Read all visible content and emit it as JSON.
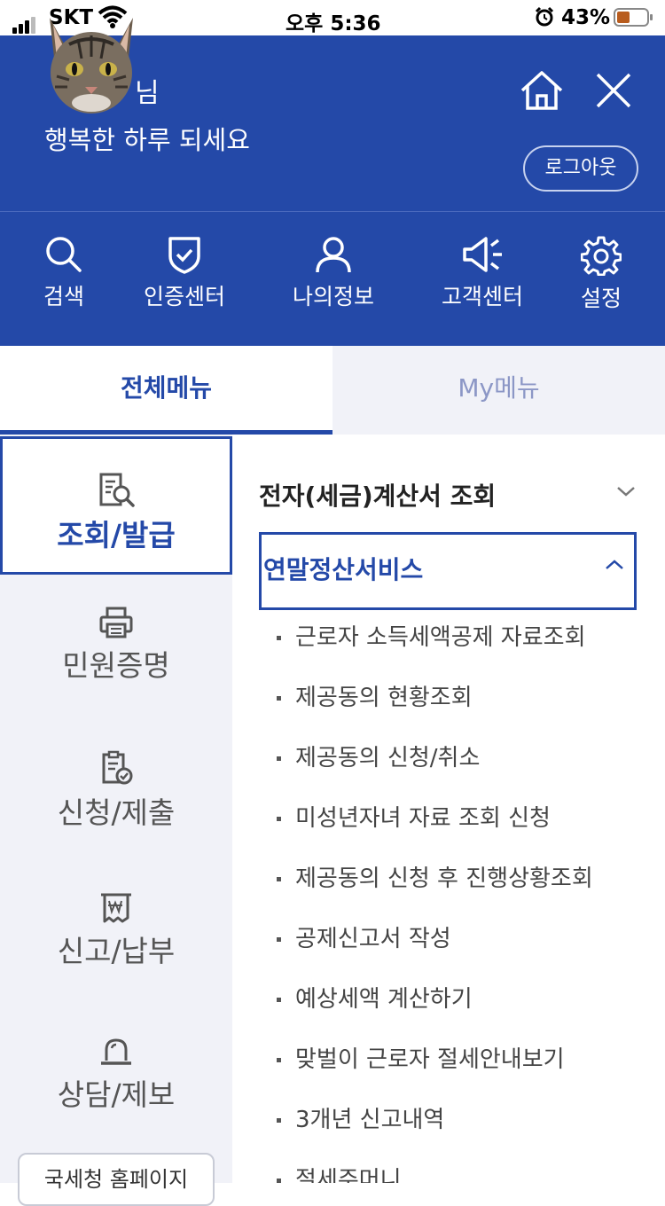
{
  "status_bar": {
    "carrier": "SKT",
    "time": "오후 5:36",
    "battery_percent": "43%",
    "battery_level": 0.43
  },
  "header": {
    "greeting_name_suffix": "님",
    "greeting_message": "행복한 하루 되세요",
    "logout_label": "로그아웃",
    "home_icon": "home-icon",
    "close_icon": "close-icon",
    "bg_color": "#2449a8"
  },
  "quick_nav": [
    {
      "label": "검색",
      "icon": "search-icon"
    },
    {
      "label": "인증센터",
      "icon": "shield-check-icon"
    },
    {
      "label": "나의정보",
      "icon": "person-icon"
    },
    {
      "label": "고객센터",
      "icon": "megaphone-icon"
    },
    {
      "label": "설정",
      "icon": "gear-icon"
    }
  ],
  "tabs": [
    {
      "label": "전체메뉴",
      "active": true
    },
    {
      "label": "My메뉴",
      "active": false
    }
  ],
  "categories": [
    {
      "label": "조회/발급",
      "icon": "document-search-icon",
      "active": true
    },
    {
      "label": "민원증명",
      "icon": "printer-icon",
      "active": false
    },
    {
      "label": "신청/제출",
      "icon": "clipboard-check-icon",
      "active": false
    },
    {
      "label": "신고/납부",
      "icon": "receipt-won-icon",
      "active": false
    },
    {
      "label": "상담/제보",
      "icon": "siren-icon",
      "active": false
    }
  ],
  "homepage_button_label": "국세청 홈페이지",
  "menu": {
    "sections": [
      {
        "title": "전자(세금)계산서 조회",
        "expanded": false
      },
      {
        "title": "연말정산서비스",
        "expanded": true
      }
    ],
    "items": [
      "근로자 소득세액공제 자료조회",
      "제공동의 현황조회",
      "제공동의 신청/취소",
      "미성년자녀 자료 조회 신청",
      "제공동의 신청 후 진행상황조회",
      "공제신고서 작성",
      "예상세액 계산하기",
      "맞벌이 근로자 절세안내보기",
      "3개년 신고내역",
      "절세주머니"
    ]
  }
}
